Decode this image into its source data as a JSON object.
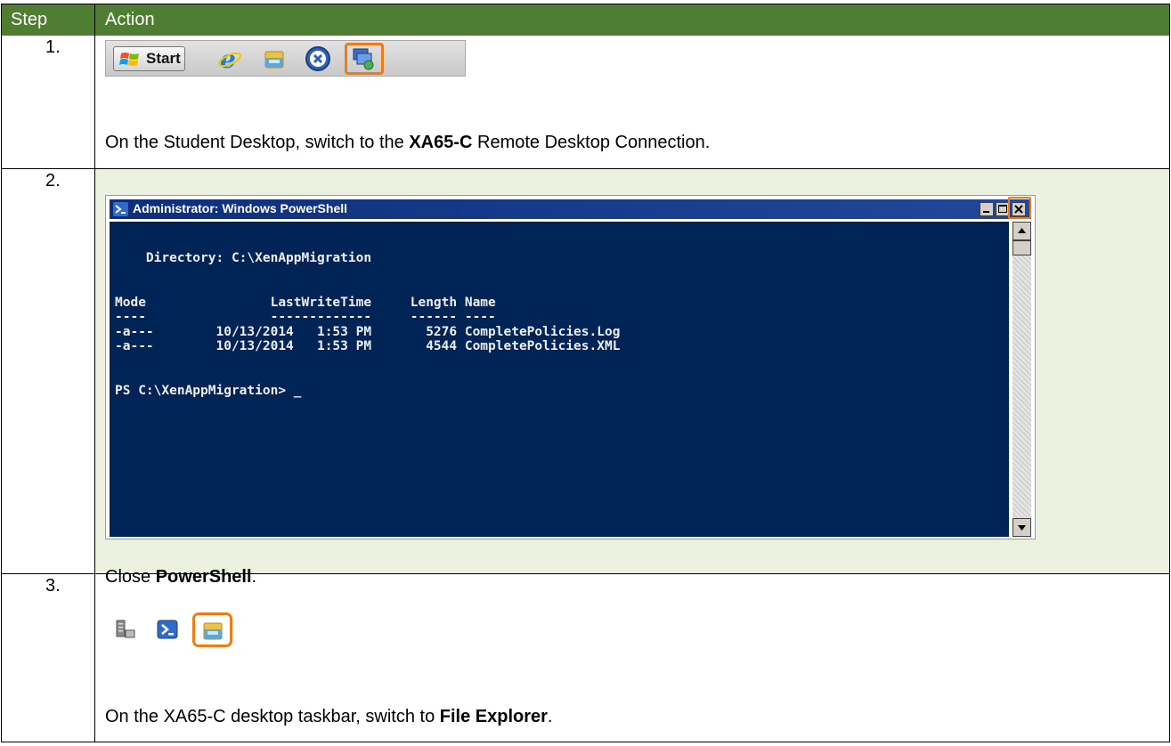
{
  "header": {
    "step_label": "Step",
    "action_label": "Action"
  },
  "steps": [
    {
      "number": "1.",
      "instruction": {
        "pre": "On the Student Desktop, switch to the ",
        "bold": "XA65-C",
        "post": " Remote Desktop Connection."
      },
      "taskbar": {
        "start_label": "Start"
      }
    },
    {
      "number": "2.",
      "instruction": {
        "pre": "Close ",
        "bold": "PowerShell",
        "post": "."
      },
      "window": {
        "title": "Administrator: Windows PowerShell",
        "console_lines": [
          "",
          "",
          "    Directory: C:\\XenAppMigration",
          "",
          "",
          "Mode                LastWriteTime     Length Name",
          "----                -------------     ------ ----",
          "-a---        10/13/2014   1:53 PM       5276 CompletePolicies.Log",
          "-a---        10/13/2014   1:53 PM       4544 CompletePolicies.XML",
          "",
          "",
          "PS C:\\XenAppMigration> _"
        ]
      }
    },
    {
      "number": "3.",
      "instruction": {
        "pre": "On the XA65-C desktop taskbar, switch to ",
        "bold": "File Explorer",
        "post": "."
      }
    }
  ],
  "colors": {
    "header_bg": "#4f7d31",
    "highlight_row_bg": "#ebf1de",
    "highlight_box": "#f07a1a",
    "console_bg": "#012456"
  }
}
